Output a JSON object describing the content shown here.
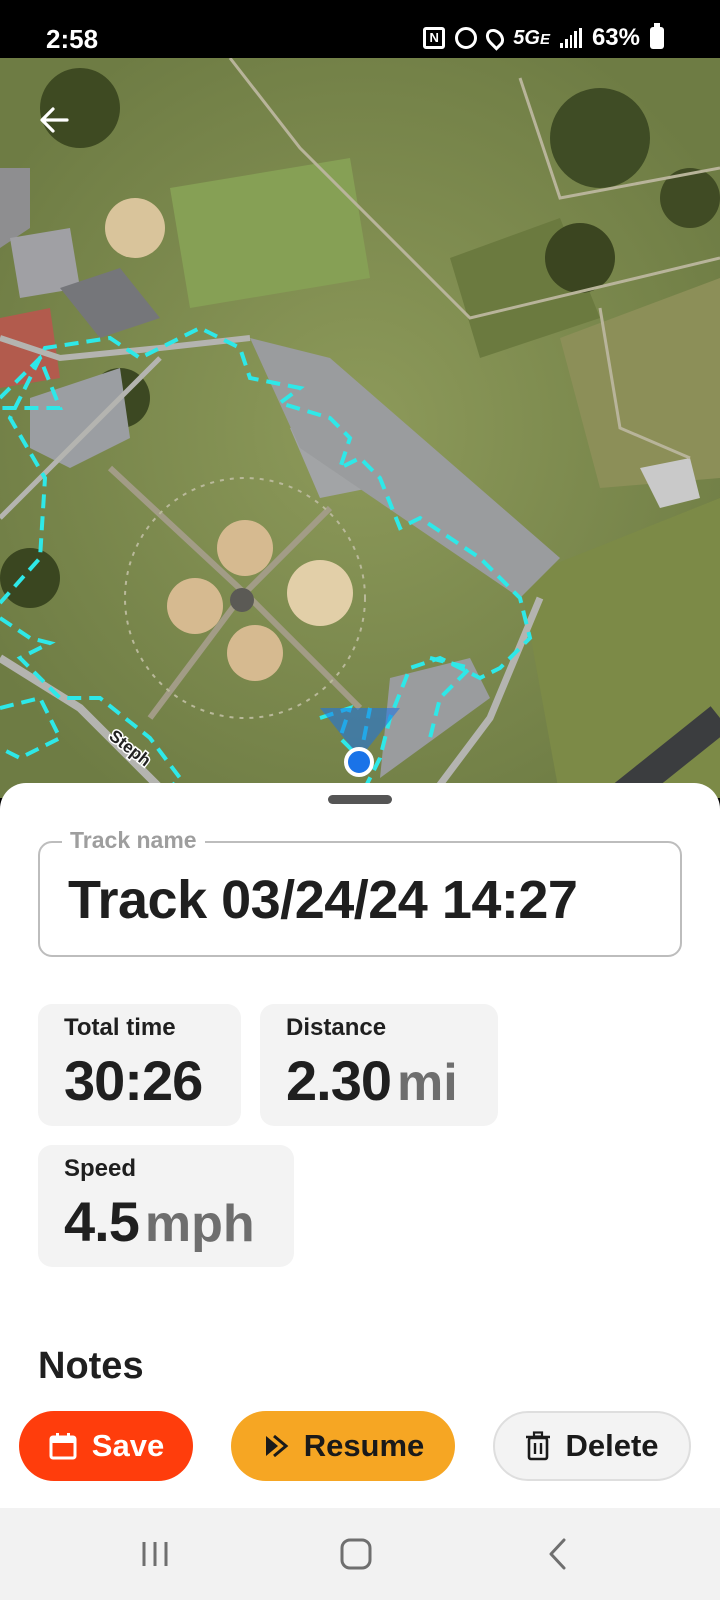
{
  "status_bar": {
    "time": "2:58",
    "network": "5G",
    "network_sub": "E",
    "battery": "63%",
    "icons": [
      "nfc-icon",
      "alarm-icon",
      "location-icon",
      "signal-icon",
      "battery-icon"
    ]
  },
  "map": {
    "street_label": "Steph",
    "back_icon": "arrow-left-icon"
  },
  "track": {
    "name_label": "Track name",
    "name_value": "Track 03/24/24 14:27"
  },
  "stats": {
    "total_time": {
      "label": "Total time",
      "value": "30:26"
    },
    "distance": {
      "label": "Distance",
      "value": "2.30",
      "unit": "mi"
    },
    "speed": {
      "label": "Speed",
      "value": "4.5",
      "unit": "mph"
    }
  },
  "notes": {
    "heading": "Notes"
  },
  "actions": {
    "save": {
      "label": "Save",
      "icon": "calendar-icon",
      "color": "#ff3d0c"
    },
    "resume": {
      "label": "Resume",
      "icon": "play-step-icon",
      "color": "#f6a623"
    },
    "delete": {
      "label": "Delete",
      "icon": "trash-icon",
      "color": "#f3f3f3"
    }
  },
  "nav_bar": {
    "recents_icon": "recents-icon",
    "home_icon": "home-icon",
    "back_icon": "back-chevron-icon"
  },
  "colors": {
    "track_line": "#2ee8e8",
    "location_dot": "#1a73e8"
  }
}
